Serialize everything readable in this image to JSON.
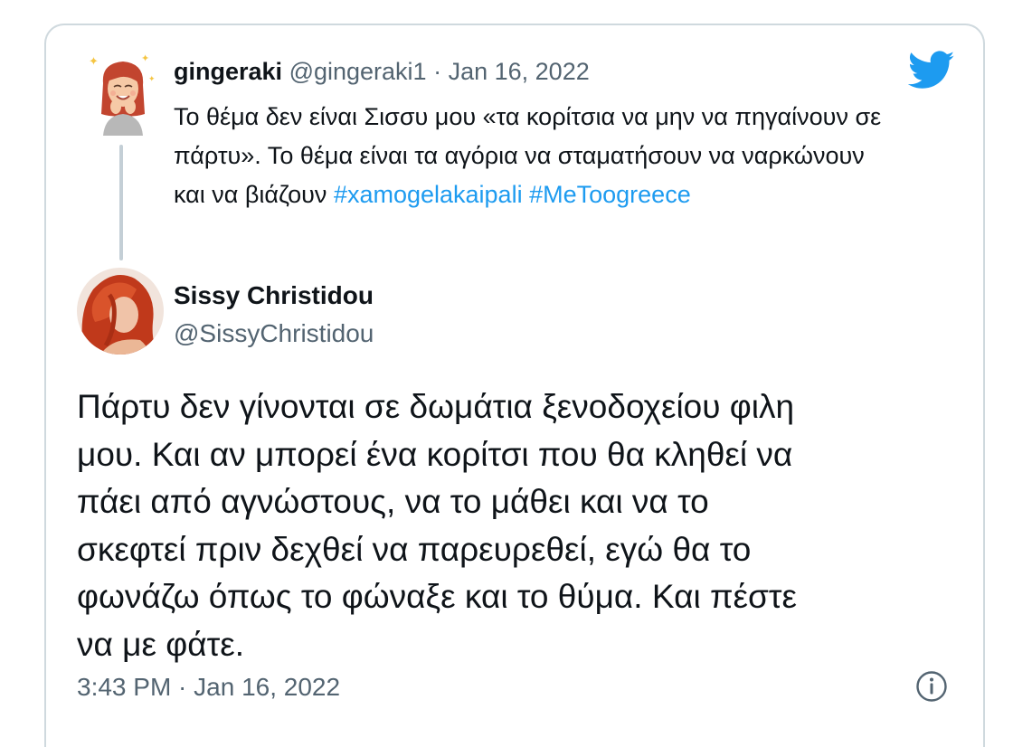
{
  "reply": {
    "display_name": "gingeraki",
    "handle": "@gingeraki1",
    "separator": "·",
    "date": "Jan 16, 2022",
    "text": "Το θέμα δεν είναι Σισσυ μου «τα κορίτσια να μην να πηγαίνουν σε πάρτυ». Το θέμα είναι τα αγόρια να σταματήσουν να ναρκώνουν και να βιάζουν",
    "hashtags": [
      "#xamogelakaipali",
      "#MeToogreece"
    ]
  },
  "tweet": {
    "display_name": "Sissy Christidou",
    "handle": "@SissyChristidou",
    "lines": [
      "Πάρτυ δεν γίνονται σε δωμάτια ξενοδοχείου φιλη",
      "μου. Και αν μπορεί ένα κορίτσι που θα κληθεί να",
      "πάει από αγνώστους, να το μάθει και να το",
      "σκεφτεί πριν δεχθεί να παρευρεθεί, εγώ θα το",
      "φωνάζω όπως το φώναξε και το θύμα. Και πέστε",
      "να με φάτε."
    ],
    "timestamp": "3:43 PM · Jan 16, 2022"
  },
  "icons": {
    "logo": "twitter-bird-icon",
    "info": "info-icon"
  },
  "colors": {
    "brand": "#1d9bf0",
    "text": "#0f1419",
    "secondary": "#536471",
    "border": "#cfd9de"
  }
}
